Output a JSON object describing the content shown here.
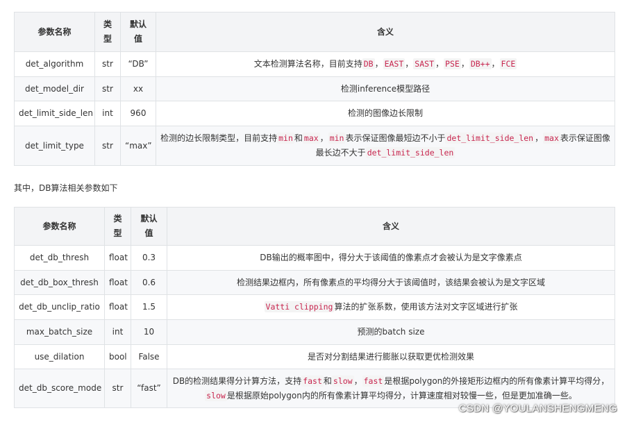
{
  "table1": {
    "headers": [
      "参数名称",
      "类型",
      "默认值",
      "含义"
    ],
    "rows": [
      {
        "name": "det_algorithm",
        "type": "str",
        "default": "“DB”",
        "desc": [
          {
            "t": "文本检测算法名称，目前支持"
          },
          {
            "c": "DB"
          },
          {
            "t": "，"
          },
          {
            "c": "EAST"
          },
          {
            "t": "，"
          },
          {
            "c": "SAST"
          },
          {
            "t": "，"
          },
          {
            "c": "PSE"
          },
          {
            "t": "，"
          },
          {
            "c": "DB++"
          },
          {
            "t": "，"
          },
          {
            "c": "FCE"
          }
        ]
      },
      {
        "name": "det_model_dir",
        "type": "str",
        "default": "xx",
        "desc": [
          {
            "t": "检测inference模型路径"
          }
        ]
      },
      {
        "name": "det_limit_side_len",
        "type": "int",
        "default": "960",
        "desc": [
          {
            "t": "检测的图像边长限制"
          }
        ]
      },
      {
        "name": "det_limit_type",
        "type": "str",
        "default": "“max”",
        "desc": [
          {
            "t": "检测的边长限制类型，目前支持"
          },
          {
            "c": "min"
          },
          {
            "t": "和"
          },
          {
            "c": "max"
          },
          {
            "t": "，"
          },
          {
            "c": "min"
          },
          {
            "t": "表示保证图像最短边不小于"
          },
          {
            "c": "det_limit_side_len"
          },
          {
            "t": "，"
          },
          {
            "c": "max"
          },
          {
            "t": "表示保证图像最长边不大于"
          },
          {
            "c": "det_limit_side_len"
          }
        ]
      }
    ]
  },
  "sentence": "其中，DB算法相关参数如下",
  "table2": {
    "headers": [
      "参数名称",
      "类型",
      "默认值",
      "含义"
    ],
    "rows": [
      {
        "name": "det_db_thresh",
        "type": "float",
        "default": "0.3",
        "desc": [
          {
            "t": "DB输出的概率图中，得分大于该阈值的像素点才会被认为是文字像素点"
          }
        ]
      },
      {
        "name": "det_db_box_thresh",
        "type": "float",
        "default": "0.6",
        "desc": [
          {
            "t": "检测结果边框内，所有像素点的平均得分大于该阈值时，该结果会被认为是文字区域"
          }
        ]
      },
      {
        "name": "det_db_unclip_ratio",
        "type": "float",
        "default": "1.5",
        "desc": [
          {
            "c": "Vatti clipping"
          },
          {
            "t": "算法的扩张系数，使用该方法对文字区域进行扩张"
          }
        ]
      },
      {
        "name": "max_batch_size",
        "type": "int",
        "default": "10",
        "desc": [
          {
            "t": "预测的batch size"
          }
        ]
      },
      {
        "name": "use_dilation",
        "type": "bool",
        "default": "False",
        "desc": [
          {
            "t": "是否对分割结果进行膨胀以获取更优检测效果"
          }
        ]
      },
      {
        "name": "det_db_score_mode",
        "type": "str",
        "default": "“fast”",
        "desc": [
          {
            "t": "DB的检测结果得分计算方法，支持"
          },
          {
            "c": "fast"
          },
          {
            "t": "和"
          },
          {
            "c": "slow"
          },
          {
            "t": "，"
          },
          {
            "c": "fast"
          },
          {
            "t": "是根据polygon的外接矩形边框内的所有像素计算平均得分，"
          },
          {
            "c": "slow"
          },
          {
            "t": "是根据原始polygon内的所有像素计算平均得分，计算速度相对较慢一些，但是更加准确一些。"
          }
        ]
      }
    ]
  },
  "watermark": "CSDN @YOULANSHENGMENG"
}
